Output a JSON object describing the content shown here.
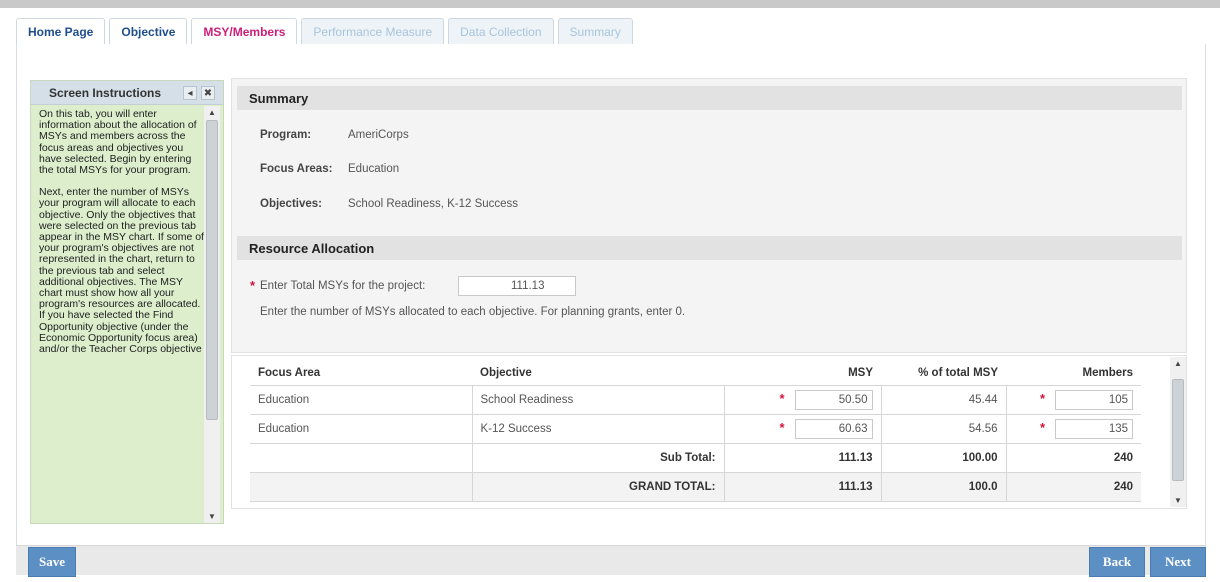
{
  "tabs": [
    {
      "label": "Home Page",
      "state": "link"
    },
    {
      "label": "Objective",
      "state": "link"
    },
    {
      "label": "MSY/Members",
      "state": "active"
    },
    {
      "label": "Performance Measure",
      "state": "disabled"
    },
    {
      "label": "Data Collection",
      "state": "disabled"
    },
    {
      "label": "Summary",
      "state": "disabled"
    }
  ],
  "instructions": {
    "title": "Screen Instructions",
    "collapse_glyph": "◂",
    "close_glyph": "✖",
    "paragraphs": [
      "On this tab, you will enter information about the allocation of MSYs and members across the focus areas and objectives you have selected. Begin by entering the total MSYs for your program.",
      "Next, enter the number of MSYs your program will allocate to each objective. Only the objectives that were selected on the previous tab appear in the MSY chart. If some of your program's objectives are not represented in the chart, return to the previous tab and select additional objectives. The MSY chart must show how all your program's resources are allocated. If you have selected the Find Opportunity objective (under the Economic Opportunity focus area) and/or the Teacher Corps objective"
    ]
  },
  "summary": {
    "heading": "Summary",
    "program_label": "Program:",
    "program_value": "AmeriCorps",
    "focus_label": "Focus Areas:",
    "focus_value": "Education",
    "objectives_label": "Objectives:",
    "objectives_value": "School Readiness, K-12 Success"
  },
  "resource": {
    "heading": "Resource Allocation",
    "required_mark": "*",
    "total_label": "Enter Total MSYs for the project:",
    "total_value": "111.13",
    "note": "Enter the number of MSYs allocated to each objective. For planning grants, enter 0."
  },
  "table": {
    "headers": [
      "Focus Area",
      "Objective",
      "MSY",
      "% of total MSY",
      "Members"
    ],
    "rows": [
      {
        "focus": "Education",
        "objective": "School Readiness",
        "msy": "50.50",
        "pct": "45.44",
        "members": "105"
      },
      {
        "focus": "Education",
        "objective": "K-12 Success",
        "msy": "60.63",
        "pct": "54.56",
        "members": "135"
      }
    ],
    "subtotal": {
      "label": "Sub Total:",
      "msy": "111.13",
      "pct": "100.00",
      "members": "240"
    },
    "grandtotal": {
      "label": "GRAND TOTAL:",
      "msy": "111.13",
      "pct": "100.0",
      "members": "240"
    }
  },
  "buttons": {
    "save": "Save",
    "back": "Back",
    "next": "Next"
  },
  "colors": {
    "accent_tab": "#cc1f7a",
    "link_tab": "#1f4e8c",
    "button": "#5c8fc4",
    "instructions_bg": "#dceecc",
    "required": "#d3143a"
  }
}
